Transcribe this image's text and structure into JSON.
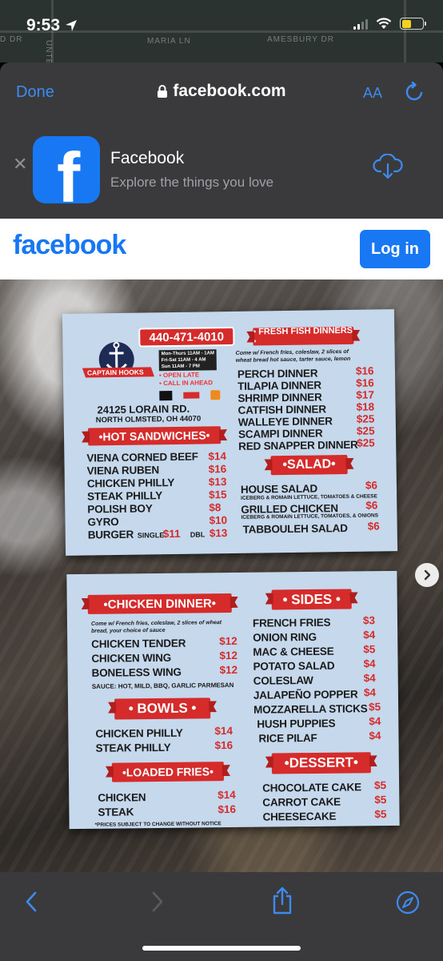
{
  "status": {
    "time": "9:53",
    "map_streets": [
      "MARIA LN",
      "AMESBURY DR",
      "D DR",
      "UNTE"
    ]
  },
  "browser": {
    "done_label": "Done",
    "url": "facebook.com",
    "aa_label": "AA"
  },
  "app_banner": {
    "title": "Facebook",
    "subtitle": "Explore the things you love"
  },
  "fb_header": {
    "logo": "facebook",
    "login_label": "Log in"
  },
  "menu": {
    "phone": "440-471-4010",
    "logo_text": "CAPTAIN HOOKS",
    "hours": [
      "Mon-Thurs 11AM - 1AM",
      "Fri-Sat 11AM - 4 AM",
      "Sun 11AM - 7 PM"
    ],
    "perks": [
      "• OPEN LATE",
      "• CALL IN AHEAD"
    ],
    "address": "24125 LORAIN RD.",
    "city": "NORTH OLMSTED, OH 44070",
    "hot_sandwiches": {
      "title": "•HOT SANDWICHES•",
      "items": [
        {
          "name": "VIENA CORNED BEEF",
          "price": "$14"
        },
        {
          "name": "VIENA RUBEN",
          "price": "$16"
        },
        {
          "name": "CHICKEN PHILLY",
          "price": "$13"
        },
        {
          "name": "STEAK PHILLY",
          "price": "$15"
        },
        {
          "name": "POLISH BOY",
          "price": "$8"
        },
        {
          "name": "GYRO",
          "price": "$10"
        }
      ],
      "burger": {
        "name": "BURGER",
        "single_label": "SINGLE",
        "single_price": "$11",
        "dbl_label": "DBL",
        "dbl_price": "$13"
      }
    },
    "fresh_fish": {
      "title": "• FRESH FISH DINNERS •",
      "note": "Come w/ French fries, coleslaw, 2 slices of wheat bread hot sauce, tarter sauce, lemon",
      "items": [
        {
          "name": "PERCH DINNER",
          "price": "$16"
        },
        {
          "name": "TILAPIA DINNER",
          "price": "$16"
        },
        {
          "name": "SHRIMP DINNER",
          "price": "$17"
        },
        {
          "name": "CATFISH DINNER",
          "price": "$18"
        },
        {
          "name": "WALLEYE DINNER",
          "price": "$25"
        },
        {
          "name": "SCAMPI DINNER",
          "price": "$25"
        },
        {
          "name": "RED SNAPPER DINNER",
          "price": "$25"
        }
      ]
    },
    "salad": {
      "title": "•SALAD•",
      "items": [
        {
          "name": "HOUSE SALAD",
          "price": "$6",
          "note": "ICEBERG & ROMAIN LETTUCE, TOMATOES & CHEESE"
        },
        {
          "name": "GRILLED CHICKEN",
          "price": "$6",
          "note": "ICEBERG & ROMAIN LETTUCE, TOMATOES, & ONIONS"
        },
        {
          "name": "TABBOULEH SALAD",
          "price": "$6",
          "note": ""
        }
      ]
    },
    "chicken_dinner": {
      "title": "•CHICKEN DINNER•",
      "note": "Come w/ French fries, coleslaw, 2 slices of wheat bread, your choice of sauce",
      "items": [
        {
          "name": "CHICKEN TENDER",
          "price": "$12"
        },
        {
          "name": "CHICKEN WING",
          "price": "$12"
        },
        {
          "name": "BONELESS WING",
          "price": "$12"
        }
      ],
      "sauces": "SAUCE: HOT, MILD, BBQ, GARLIC PARMESAN"
    },
    "bowls": {
      "title": "• BOWLS •",
      "items": [
        {
          "name": "CHICKEN PHILLY",
          "price": "$14"
        },
        {
          "name": "STEAK PHILLY",
          "price": "$16"
        }
      ]
    },
    "loaded_fries": {
      "title": "•LOADED FRIES•",
      "items": [
        {
          "name": "CHICKEN",
          "price": "$14"
        },
        {
          "name": "STEAK",
          "price": "$16"
        }
      ],
      "footnote": "*PRICES SUBJECT TO CHANGE WITHOUT NOTICE"
    },
    "sides": {
      "title": "• SIDES •",
      "items": [
        {
          "name": "FRENCH FRIES",
          "price": "$3"
        },
        {
          "name": "ONION RING",
          "price": "$4"
        },
        {
          "name": "MAC & CHEESE",
          "price": "$5"
        },
        {
          "name": "POTATO SALAD",
          "price": "$4"
        },
        {
          "name": "COLESLAW",
          "price": "$4"
        },
        {
          "name": "JALAPEÑO POPPER",
          "price": "$4"
        },
        {
          "name": "MOZZARELLA STICKS",
          "price": "$5"
        },
        {
          "name": "HUSH PUPPIES",
          "price": "$4"
        },
        {
          "name": "RICE PILAF",
          "price": "$4"
        }
      ]
    },
    "dessert": {
      "title": "•DESSERT•",
      "items": [
        {
          "name": "CHOCOLATE CAKE",
          "price": "$5"
        },
        {
          "name": "CARROT CAKE",
          "price": "$5"
        },
        {
          "name": "CHEESECAKE",
          "price": "$5"
        }
      ]
    }
  },
  "colors": {
    "ios_blue": "#3d8bf0",
    "facebook_blue": "#1877f2",
    "menu_red": "#d62b2b",
    "card_blue": "#c6d8ec",
    "sheet_gray": "#3a3a3c"
  },
  "icons": [
    "location-arrow-icon",
    "signal-icon",
    "wifi-icon",
    "battery-icon",
    "lock-icon",
    "reload-icon",
    "close-icon",
    "download-cloud-icon",
    "chevron-right-icon",
    "back-icon",
    "forward-icon",
    "share-icon",
    "compass-icon"
  ]
}
